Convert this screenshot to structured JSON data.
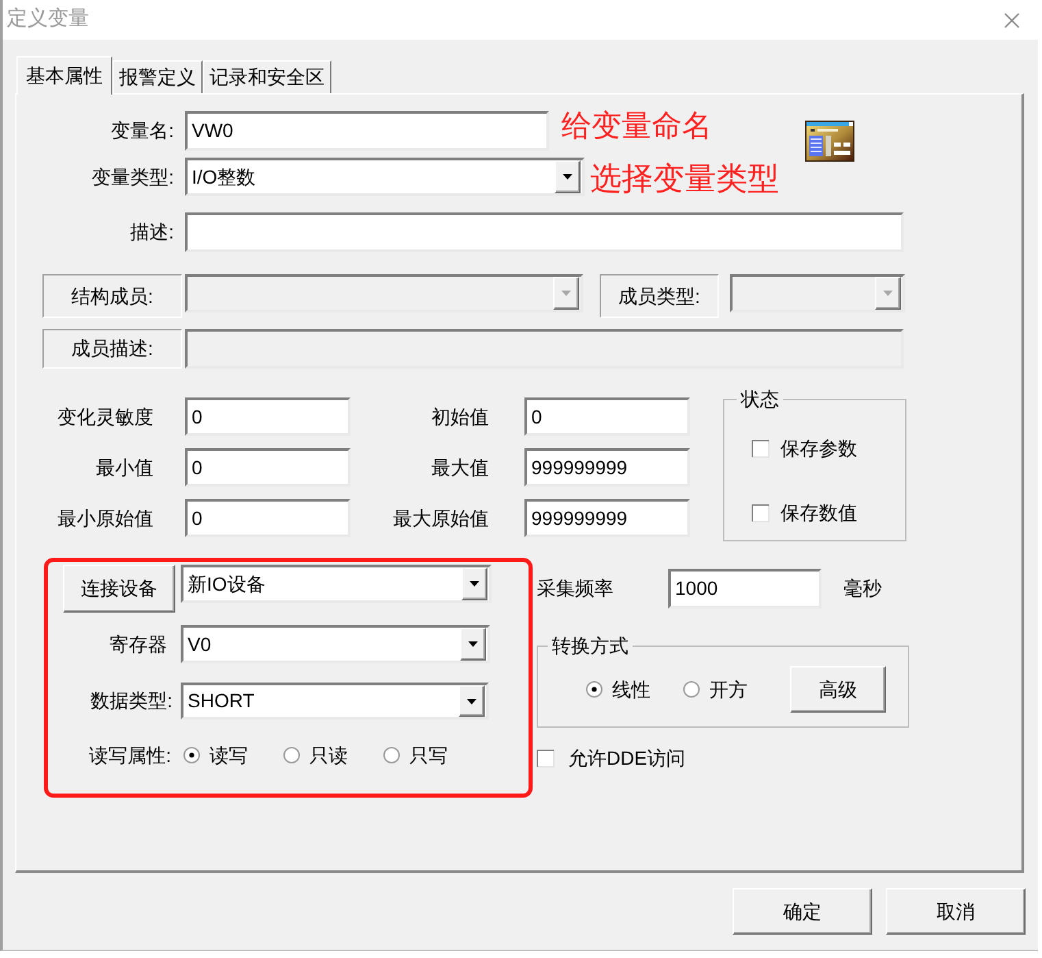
{
  "window": {
    "title": "定义变量"
  },
  "tabs": [
    {
      "label": "基本属性",
      "selected": true
    },
    {
      "label": "报警定义",
      "selected": false
    },
    {
      "label": "记录和安全区",
      "selected": false
    }
  ],
  "variable": {
    "name": {
      "label": "变量名:",
      "value": "VW0",
      "annotation": "给变量命名"
    },
    "type": {
      "label": "变量类型:",
      "value": "I/O整数",
      "annotation": "选择变量类型"
    },
    "description": {
      "label": "描述:"
    }
  },
  "structure": {
    "member": {
      "label": "结构成员:",
      "disabled": true
    },
    "member_type": {
      "label": "成员类型:",
      "disabled": true
    },
    "member_description": {
      "label": "成员描述:",
      "disabled": true
    }
  },
  "values": [
    {
      "label": "变化灵敏度",
      "value": "0"
    },
    {
      "label": "初始值",
      "value": "0"
    },
    {
      "label": "最小值",
      "value": "0"
    },
    {
      "label": "最大值",
      "value": "999999999"
    },
    {
      "label": "最小原始值",
      "value": "0"
    },
    {
      "label": "最大原始值",
      "value": "999999999"
    }
  ],
  "status": {
    "title": "状态",
    "options": [
      {
        "label": "保存参数",
        "checked": false
      },
      {
        "label": "保存数值",
        "checked": false
      }
    ]
  },
  "io": {
    "highlighted": true,
    "connect_button": "连接设备",
    "device": {
      "value": "新IO设备"
    },
    "register": {
      "label": "寄存器",
      "value": "V0"
    },
    "data_type": {
      "label": "数据类型:",
      "value": "SHORT"
    },
    "access": {
      "label": "读写属性:",
      "options": [
        {
          "label": "读写",
          "selected": true
        },
        {
          "label": "只读",
          "selected": false
        },
        {
          "label": "只写",
          "selected": false
        }
      ]
    }
  },
  "sampling": {
    "label": "采集频率",
    "value": "1000",
    "unit": "毫秒"
  },
  "conversion": {
    "title": "转换方式",
    "options": [
      {
        "label": "线性",
        "selected": true
      },
      {
        "label": "开方",
        "selected": false
      }
    ],
    "advanced_button": "高级"
  },
  "dde": {
    "label": "允许DDE访问",
    "checked": false
  },
  "buttons": [
    "确定",
    "取消"
  ]
}
